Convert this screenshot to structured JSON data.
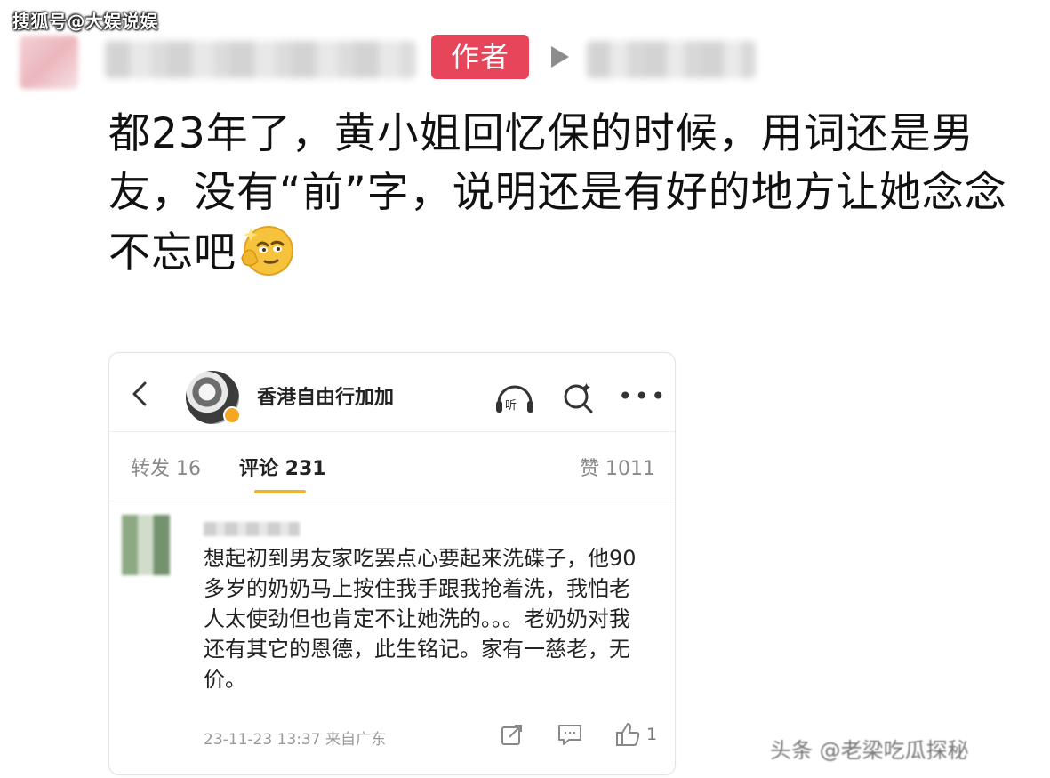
{
  "watermark_top": "搜狐号@大娱说娱",
  "post_header": {
    "author_badge": "作者"
  },
  "post": {
    "text": "都23年了，黄小姐回忆保的时候，用词还是男友，没有“前”字，说明还是有好的地方让她念念不忘吧",
    "emoji_icon": "thinking-face-emoji"
  },
  "embedded_card": {
    "account_name": "香港自由行加加",
    "tabs": {
      "repost": "转发 16",
      "comment": "评论 231",
      "like": "赞 1011"
    },
    "comment": {
      "body": "想起初到男友家吃罢点心要起来洗碟子，他90多岁的奶奶马上按住我手跟我抢着洗，我怕老人太使劲但也肯定不让她洗的。。。老奶奶对我还有其它的恩德，此生铭记。家有一慈老，无价。",
      "meta": "23-11-23 13:37 来自广东",
      "like_count": "1"
    }
  },
  "watermark_bottom": "头条 @老梁吃瓜探秘",
  "colors": {
    "author_badge_bg": "#e6455a",
    "tab_underline": "#f0b429"
  }
}
